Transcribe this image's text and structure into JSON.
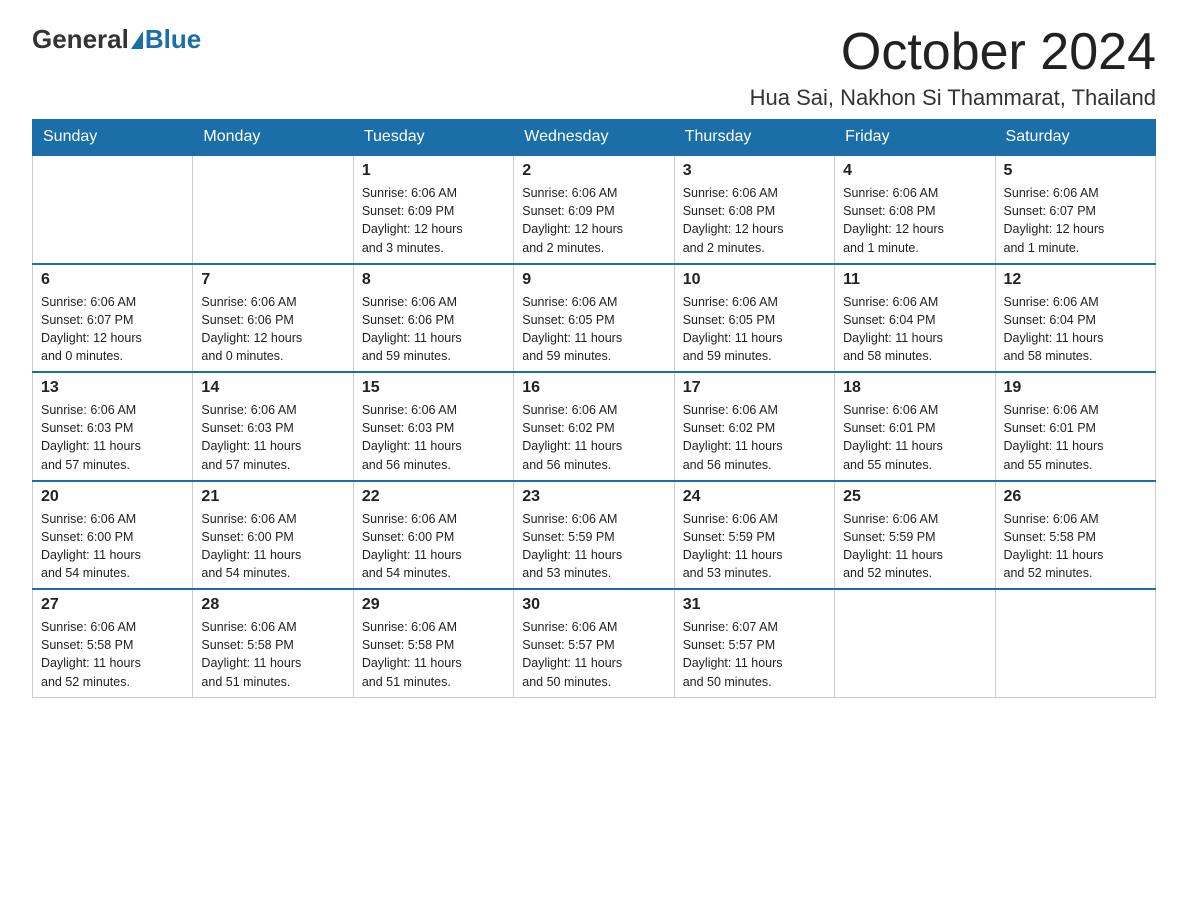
{
  "header": {
    "logo_general": "General",
    "logo_blue": "Blue",
    "month_title": "October 2024",
    "location": "Hua Sai, Nakhon Si Thammarat, Thailand"
  },
  "days_of_week": [
    "Sunday",
    "Monday",
    "Tuesday",
    "Wednesday",
    "Thursday",
    "Friday",
    "Saturday"
  ],
  "weeks": [
    [
      {
        "day": "",
        "info": ""
      },
      {
        "day": "",
        "info": ""
      },
      {
        "day": "1",
        "info": "Sunrise: 6:06 AM\nSunset: 6:09 PM\nDaylight: 12 hours\nand 3 minutes."
      },
      {
        "day": "2",
        "info": "Sunrise: 6:06 AM\nSunset: 6:09 PM\nDaylight: 12 hours\nand 2 minutes."
      },
      {
        "day": "3",
        "info": "Sunrise: 6:06 AM\nSunset: 6:08 PM\nDaylight: 12 hours\nand 2 minutes."
      },
      {
        "day": "4",
        "info": "Sunrise: 6:06 AM\nSunset: 6:08 PM\nDaylight: 12 hours\nand 1 minute."
      },
      {
        "day": "5",
        "info": "Sunrise: 6:06 AM\nSunset: 6:07 PM\nDaylight: 12 hours\nand 1 minute."
      }
    ],
    [
      {
        "day": "6",
        "info": "Sunrise: 6:06 AM\nSunset: 6:07 PM\nDaylight: 12 hours\nand 0 minutes."
      },
      {
        "day": "7",
        "info": "Sunrise: 6:06 AM\nSunset: 6:06 PM\nDaylight: 12 hours\nand 0 minutes."
      },
      {
        "day": "8",
        "info": "Sunrise: 6:06 AM\nSunset: 6:06 PM\nDaylight: 11 hours\nand 59 minutes."
      },
      {
        "day": "9",
        "info": "Sunrise: 6:06 AM\nSunset: 6:05 PM\nDaylight: 11 hours\nand 59 minutes."
      },
      {
        "day": "10",
        "info": "Sunrise: 6:06 AM\nSunset: 6:05 PM\nDaylight: 11 hours\nand 59 minutes."
      },
      {
        "day": "11",
        "info": "Sunrise: 6:06 AM\nSunset: 6:04 PM\nDaylight: 11 hours\nand 58 minutes."
      },
      {
        "day": "12",
        "info": "Sunrise: 6:06 AM\nSunset: 6:04 PM\nDaylight: 11 hours\nand 58 minutes."
      }
    ],
    [
      {
        "day": "13",
        "info": "Sunrise: 6:06 AM\nSunset: 6:03 PM\nDaylight: 11 hours\nand 57 minutes."
      },
      {
        "day": "14",
        "info": "Sunrise: 6:06 AM\nSunset: 6:03 PM\nDaylight: 11 hours\nand 57 minutes."
      },
      {
        "day": "15",
        "info": "Sunrise: 6:06 AM\nSunset: 6:03 PM\nDaylight: 11 hours\nand 56 minutes."
      },
      {
        "day": "16",
        "info": "Sunrise: 6:06 AM\nSunset: 6:02 PM\nDaylight: 11 hours\nand 56 minutes."
      },
      {
        "day": "17",
        "info": "Sunrise: 6:06 AM\nSunset: 6:02 PM\nDaylight: 11 hours\nand 56 minutes."
      },
      {
        "day": "18",
        "info": "Sunrise: 6:06 AM\nSunset: 6:01 PM\nDaylight: 11 hours\nand 55 minutes."
      },
      {
        "day": "19",
        "info": "Sunrise: 6:06 AM\nSunset: 6:01 PM\nDaylight: 11 hours\nand 55 minutes."
      }
    ],
    [
      {
        "day": "20",
        "info": "Sunrise: 6:06 AM\nSunset: 6:00 PM\nDaylight: 11 hours\nand 54 minutes."
      },
      {
        "day": "21",
        "info": "Sunrise: 6:06 AM\nSunset: 6:00 PM\nDaylight: 11 hours\nand 54 minutes."
      },
      {
        "day": "22",
        "info": "Sunrise: 6:06 AM\nSunset: 6:00 PM\nDaylight: 11 hours\nand 54 minutes."
      },
      {
        "day": "23",
        "info": "Sunrise: 6:06 AM\nSunset: 5:59 PM\nDaylight: 11 hours\nand 53 minutes."
      },
      {
        "day": "24",
        "info": "Sunrise: 6:06 AM\nSunset: 5:59 PM\nDaylight: 11 hours\nand 53 minutes."
      },
      {
        "day": "25",
        "info": "Sunrise: 6:06 AM\nSunset: 5:59 PM\nDaylight: 11 hours\nand 52 minutes."
      },
      {
        "day": "26",
        "info": "Sunrise: 6:06 AM\nSunset: 5:58 PM\nDaylight: 11 hours\nand 52 minutes."
      }
    ],
    [
      {
        "day": "27",
        "info": "Sunrise: 6:06 AM\nSunset: 5:58 PM\nDaylight: 11 hours\nand 52 minutes."
      },
      {
        "day": "28",
        "info": "Sunrise: 6:06 AM\nSunset: 5:58 PM\nDaylight: 11 hours\nand 51 minutes."
      },
      {
        "day": "29",
        "info": "Sunrise: 6:06 AM\nSunset: 5:58 PM\nDaylight: 11 hours\nand 51 minutes."
      },
      {
        "day": "30",
        "info": "Sunrise: 6:06 AM\nSunset: 5:57 PM\nDaylight: 11 hours\nand 50 minutes."
      },
      {
        "day": "31",
        "info": "Sunrise: 6:07 AM\nSunset: 5:57 PM\nDaylight: 11 hours\nand 50 minutes."
      },
      {
        "day": "",
        "info": ""
      },
      {
        "day": "",
        "info": ""
      }
    ]
  ]
}
